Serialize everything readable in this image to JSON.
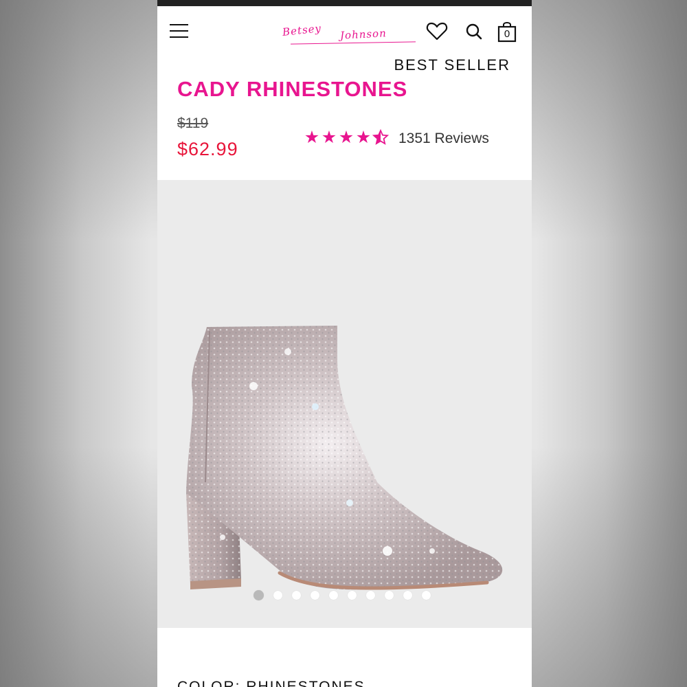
{
  "header": {
    "brand_line1": "Betsey",
    "brand_line2": "Johnson",
    "bag_count": "0",
    "icons": [
      "menu-icon",
      "heart-icon",
      "search-icon",
      "shopping-bag-icon"
    ]
  },
  "product": {
    "badge": "BEST SELLER",
    "title": "CADY RHINESTONES",
    "original_price": "$119",
    "sale_price": "$62.99",
    "rating": 4.5,
    "reviews_text": "1351 Reviews",
    "color_label": "COLOR: RHINESTONES"
  },
  "gallery": {
    "image_count": 10,
    "active_index": 0
  },
  "colors": {
    "brand_pink": "#e8158f",
    "sale_red": "#e8153a"
  }
}
